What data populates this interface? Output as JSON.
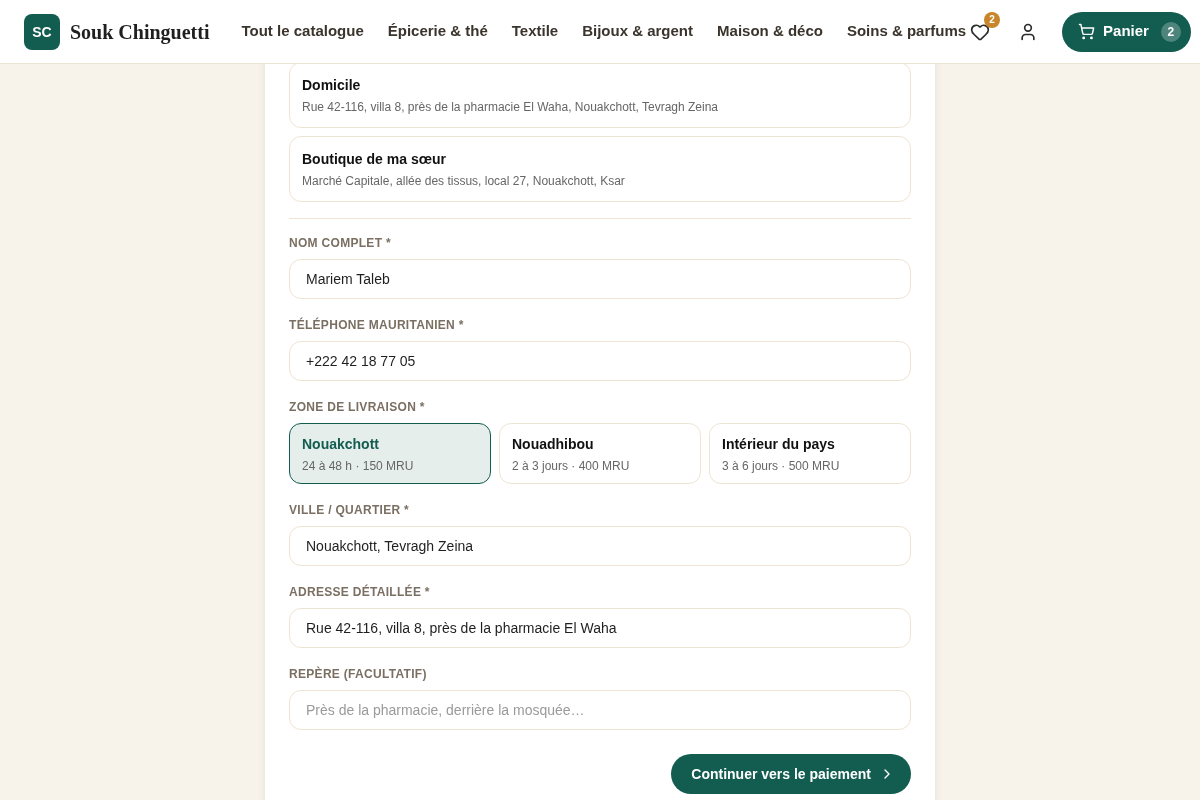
{
  "brand": {
    "logo": "SC",
    "name": "Souk Chinguetti"
  },
  "nav": [
    "Tout le catalogue",
    "Épicerie & thé",
    "Textile",
    "Bijoux & argent",
    "Maison & déco",
    "Soins & parfums"
  ],
  "wishlist_count": "2",
  "cart": {
    "label": "Panier",
    "count": "2"
  },
  "saved_addresses": [
    {
      "name": "Domicile",
      "address": "Rue 42-116, villa 8, près de la pharmacie El Waha, Nouakchott, Tevragh Zeina"
    },
    {
      "name": "Boutique de ma sœur",
      "address": "Marché Capitale, allée des tissus, local 27, Nouakchott, Ksar"
    }
  ],
  "fields_top": [
    {
      "label": "NOM COMPLET *",
      "value": "Mariem Taleb"
    },
    {
      "label": "TÉLÉPHONE MAURITANIEN *",
      "value": "+222 42 18 77 05"
    }
  ],
  "zone": {
    "label": "ZONE DE LIVRAISON *",
    "options": [
      {
        "name": "Nouakchott",
        "detail": "24 à 48 h · 150 MRU",
        "selected": true
      },
      {
        "name": "Nouadhibou",
        "detail": "2 à 3 jours · 400 MRU",
        "selected": false
      },
      {
        "name": "Intérieur du pays",
        "detail": "3 à 6 jours · 500 MRU",
        "selected": false
      }
    ]
  },
  "fields_bottom": [
    {
      "label": "VILLE / QUARTIER *",
      "value": "Nouakchott, Tevragh Zeina"
    },
    {
      "label": "ADRESSE DÉTAILLÉE *",
      "value": "Rue 42-116, villa 8, près de la pharmacie El Waha"
    },
    {
      "label": "REPÈRE (FACULTATIF)",
      "placeholder": "Près de la pharmacie, derrière la mosquée…"
    }
  ],
  "submit": "Continuer vers le paiement"
}
